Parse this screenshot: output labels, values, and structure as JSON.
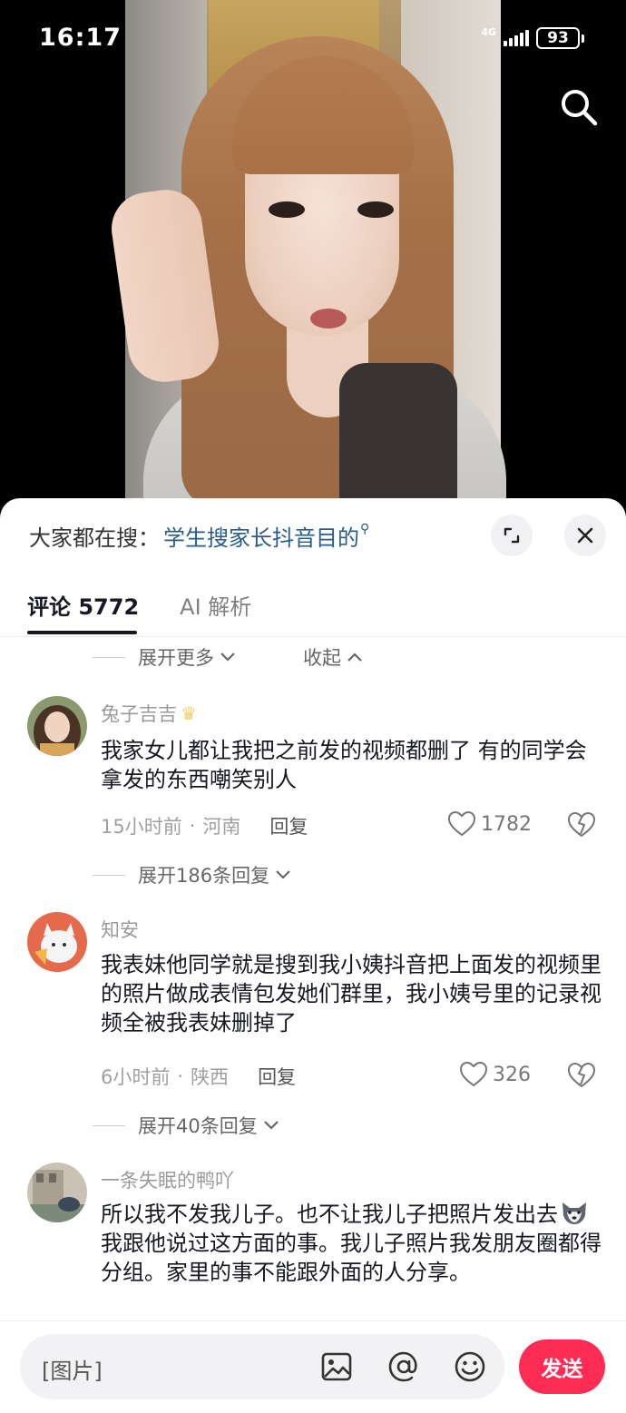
{
  "status_bar": {
    "time": "16:17",
    "network": "4G",
    "battery": "93"
  },
  "search_bar": {
    "prefix": "大家都在搜：",
    "keyword": "学生搜家长抖音目的"
  },
  "tabs": [
    {
      "label": "评论 5772",
      "active": true
    },
    {
      "label": "AI 解析",
      "active": false
    }
  ],
  "top_controls": {
    "expand_more": "展开更多",
    "collapse": "收起"
  },
  "comments": [
    {
      "username": "兔子吉吉",
      "has_crown": true,
      "text": "我家女儿都让我把之前发的视频都删了 有的同学会拿发的东西嘲笑别人",
      "time": "15小时前",
      "location": "河南",
      "reply_label": "回复",
      "likes": "1782",
      "expand_replies": "展开186条回复"
    },
    {
      "username": "知安",
      "has_crown": false,
      "text": "我表妹他同学就是搜到我小姨抖音把上面发的视频里的照片做成表情包发她们群里，我小姨号里的记录视频全被我表妹删掉了",
      "time": "6小时前",
      "location": "陕西",
      "reply_label": "回复",
      "likes": "326",
      "expand_replies": "展开40条回复"
    },
    {
      "username": "一条失眠的鸭吖",
      "has_crown": false,
      "text_part1": "所以我不发我儿子。也不让我儿子把照片发出去",
      "text_part2": "我跟他说过这方面的事。我儿子照片我发朋友圈都得分组。家里的事不能跟外面的人分享。"
    }
  ],
  "input": {
    "placeholder": "[图片]",
    "send_label": "发送"
  },
  "colors": {
    "accent": "#fe2c55",
    "keyword": "#2a5c8a",
    "text": "#161823",
    "muted": "#a0a0a0"
  }
}
